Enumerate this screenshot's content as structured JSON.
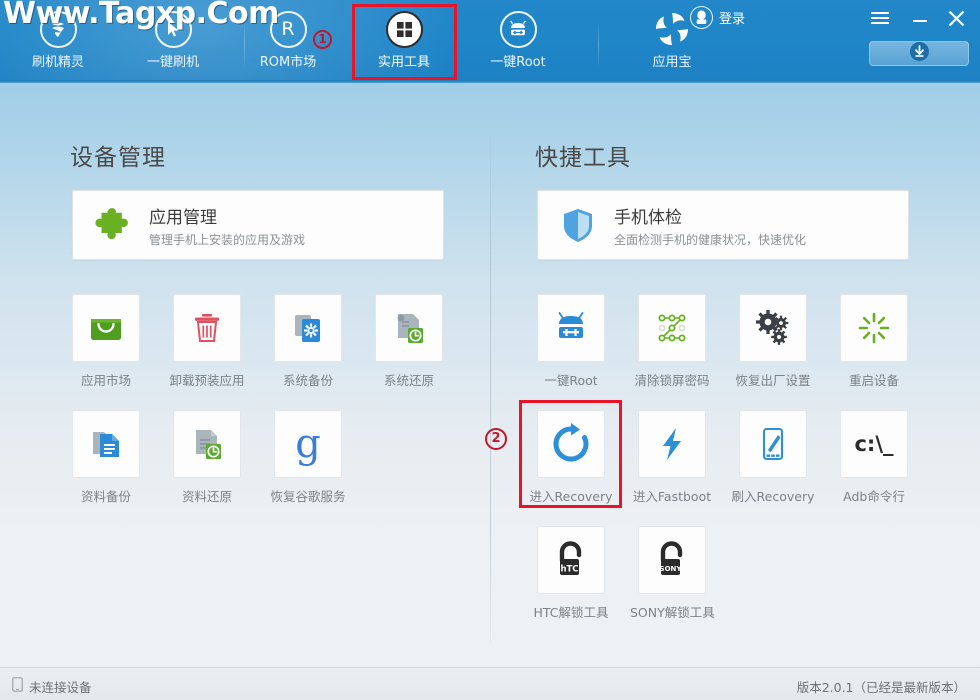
{
  "watermark": "Www.Tagxp.Com",
  "header": {
    "nav": [
      {
        "label": "刷机精灵",
        "icon": "flash-wizard-icon",
        "active": false
      },
      {
        "label": "一键刷机",
        "icon": "one-key-flash-icon",
        "active": false
      },
      {
        "label": "ROM市场",
        "icon": "rom-market-icon",
        "active": false,
        "badge": "1"
      },
      {
        "label": "实用工具",
        "icon": "utilities-grid-icon",
        "active": true
      },
      {
        "label": "一键Root",
        "icon": "one-key-root-icon",
        "active": false
      },
      {
        "label": "应用宝",
        "icon": "app-treasure-icon",
        "active": false
      }
    ],
    "login_label": "登录",
    "login_icon": "qq-penguin-avatar-icon",
    "menu_icon": "hamburger-menu-icon",
    "minimize_icon": "minimize-icon",
    "close_icon": "close-icon",
    "download_icon": "download-arrow-icon"
  },
  "left": {
    "title": "设备管理",
    "feature_card": {
      "title": "应用管理",
      "subtitle": "管理手机上安装的应用及游戏",
      "icon": "puzzle-piece-icon"
    },
    "tiles": [
      {
        "label": "应用市场",
        "icon": "shopping-bag-icon"
      },
      {
        "label": "卸载预装应用",
        "icon": "trash-can-icon"
      },
      {
        "label": "系统备份",
        "icon": "system-backup-icon"
      },
      {
        "label": "系统还原",
        "icon": "system-restore-icon"
      },
      {
        "label": "资料备份",
        "icon": "data-backup-icon"
      },
      {
        "label": "资料还原",
        "icon": "data-restore-icon"
      },
      {
        "label": "恢复谷歌服务",
        "icon": "google-g-icon"
      }
    ]
  },
  "right": {
    "title": "快捷工具",
    "feature_card": {
      "title": "手机体检",
      "subtitle": "全面检测手机的健康状况，快速优化",
      "icon": "shield-icon"
    },
    "tiles": [
      {
        "label": "一键Root",
        "icon": "android-root-icon"
      },
      {
        "label": "清除锁屏密码",
        "icon": "pattern-lock-icon"
      },
      {
        "label": "恢复出厂设置",
        "icon": "gears-icon"
      },
      {
        "label": "重启设备",
        "icon": "restart-burst-icon"
      },
      {
        "label": "进入Recovery",
        "icon": "recovery-refresh-icon",
        "highlighted": true
      },
      {
        "label": "进入Fastboot",
        "icon": "lightning-bolt-icon"
      },
      {
        "label": "刷入Recovery",
        "icon": "flash-recovery-phone-icon"
      },
      {
        "label": "Adb命令行",
        "icon": "adb-console-icon",
        "glyph": "c:\\_"
      },
      {
        "label": "HTC解锁工具",
        "icon": "htc-unlock-padlock-icon",
        "brand": "hTC"
      },
      {
        "label": "SONY解锁工具",
        "icon": "sony-unlock-padlock-icon",
        "brand": "SONY"
      }
    ]
  },
  "annotations": {
    "marker_one": "1",
    "marker_two": "2",
    "highlight_color": "#e8152a"
  },
  "footer": {
    "status_icon": "phone-outline-icon",
    "status": "未连接设备",
    "version": "版本2.0.1（已经是最新版本）"
  }
}
